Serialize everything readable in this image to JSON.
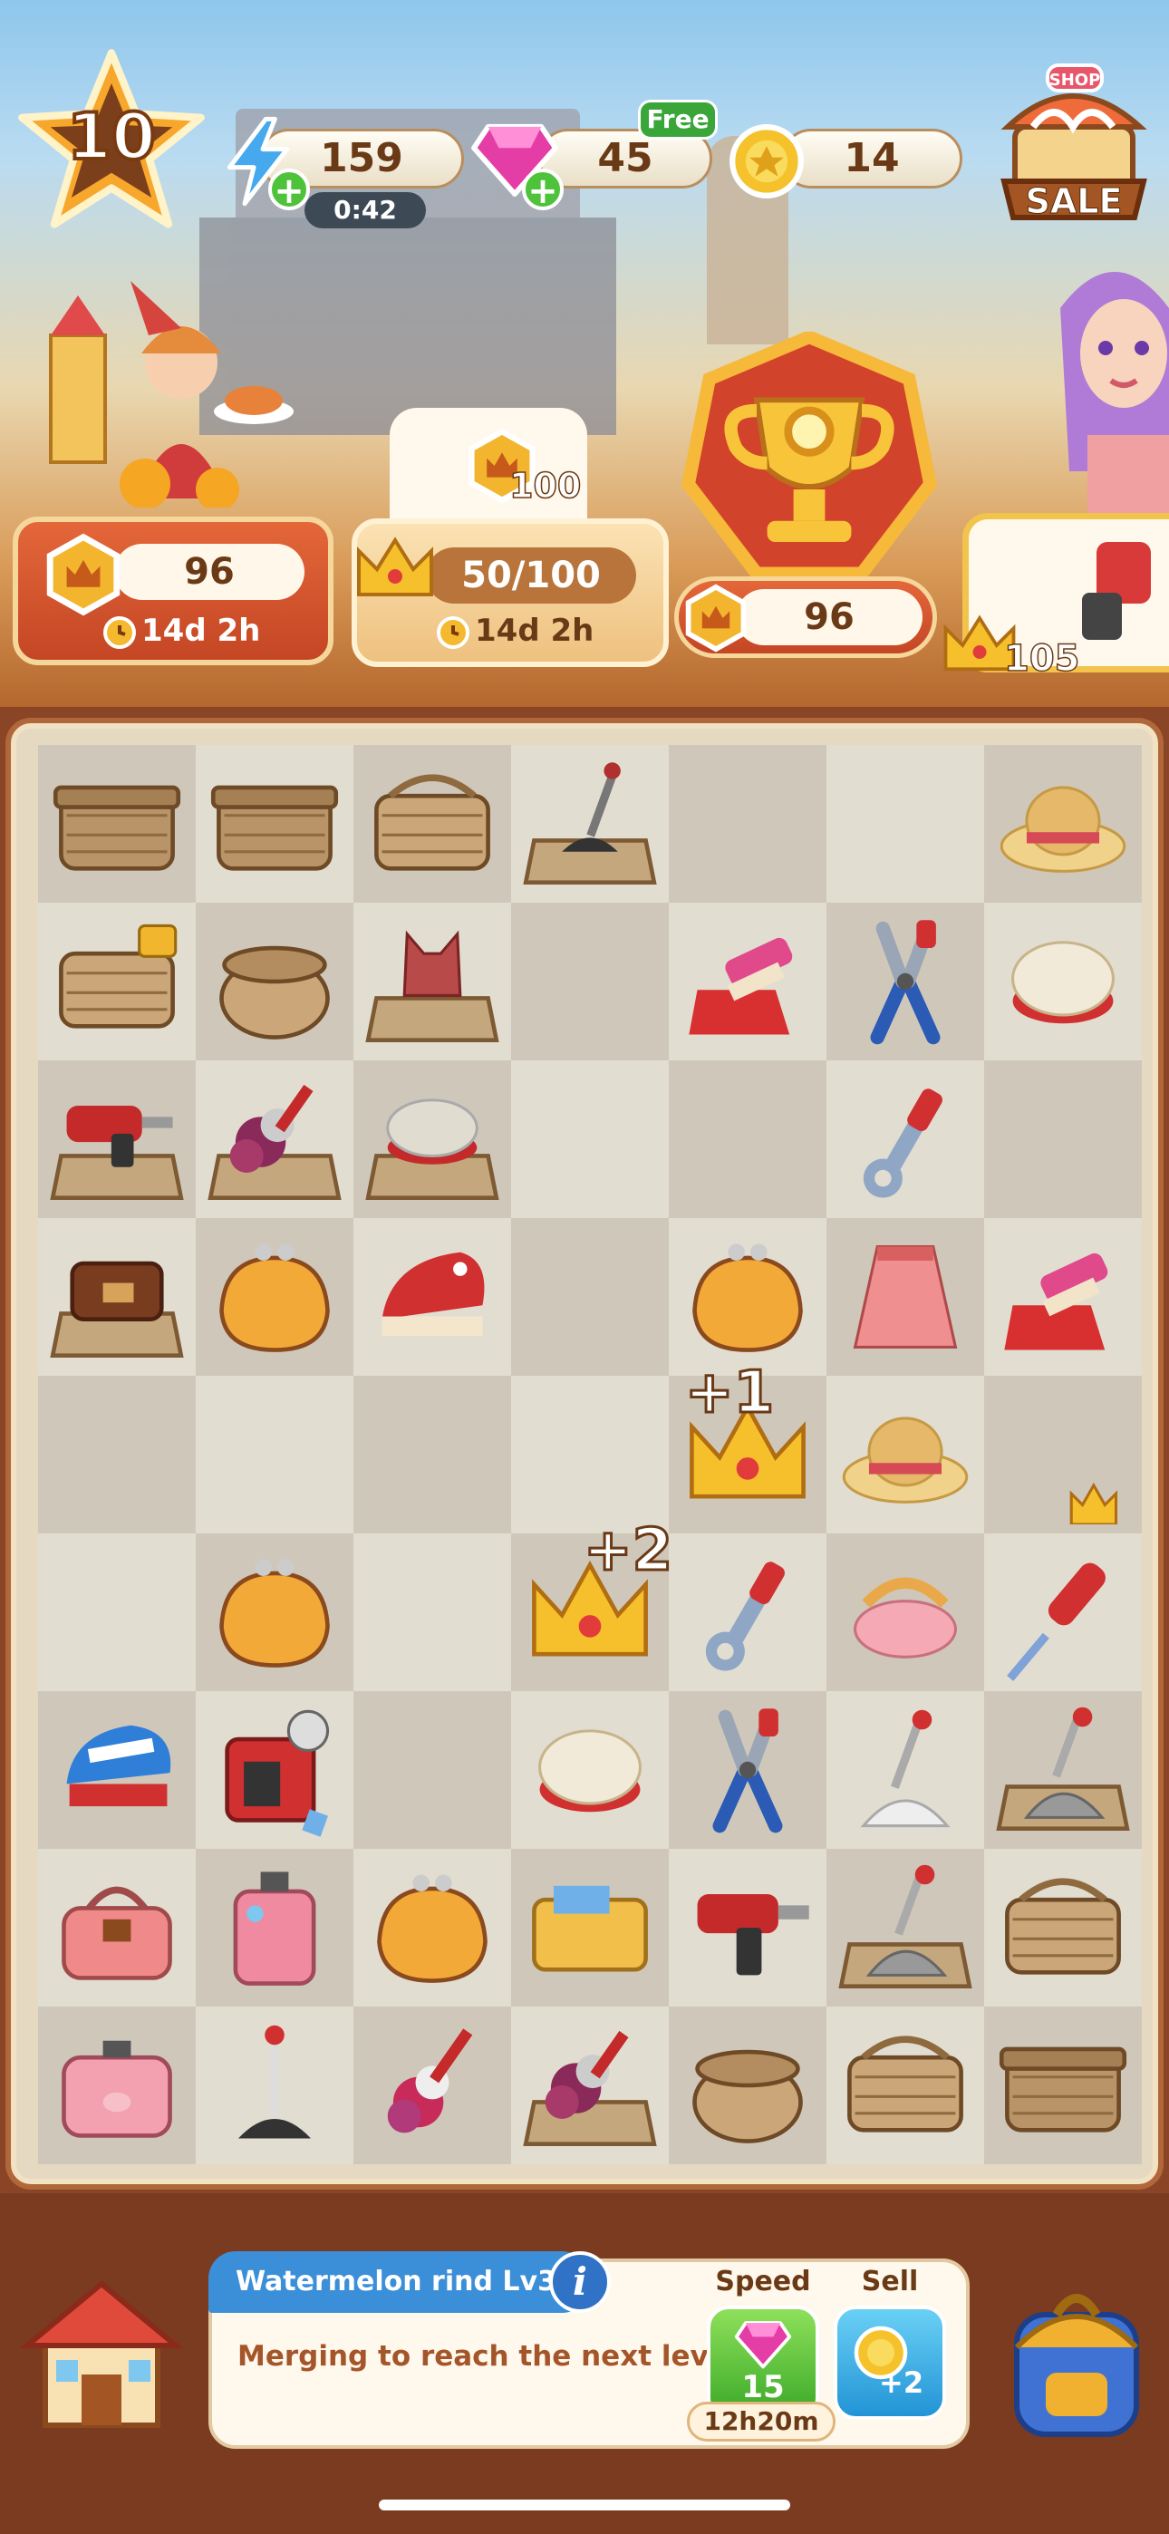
{
  "player": {
    "level": "10"
  },
  "resources": {
    "energy": "159",
    "energy_timer": "0:42",
    "gems": "45",
    "gems_badge": "Free",
    "coins": "14"
  },
  "shop": {
    "sign": "SHOP",
    "label": "SALE"
  },
  "events": {
    "left": {
      "value": "96",
      "time": "14d 2h"
    },
    "middle": {
      "reward": "100",
      "progress": "50/100",
      "time": "14d 2h"
    },
    "trophy": {
      "value": "96"
    },
    "right": {
      "value": "105"
    }
  },
  "board": {
    "floating_labels": [
      "+1",
      "+2"
    ],
    "rows": [
      [
        "picnic-basket-closed",
        "picnic-basket-closed",
        "wicker-basket",
        "plunger-on-mat",
        "",
        "",
        "straw-hat"
      ],
      [
        "wicker-basket-locked",
        "wicker-basket-round",
        "swimsuit-on-mat",
        "",
        "dustpan-brush",
        "pliers",
        "round-cake"
      ],
      [
        "power-drill-on-mat",
        "feather-duster-on-mat",
        "cake-on-mat",
        "",
        "",
        "wrench",
        ""
      ],
      [
        "leather-bag-on-mat",
        "coin-purse",
        "scrub-brush",
        "",
        "coin-purse",
        "pink-skirt",
        "dustpan-brush"
      ],
      [
        "",
        "",
        "",
        "",
        "crown-plus-one",
        "straw-hat",
        "small-crown"
      ],
      [
        "",
        "coin-purse",
        "",
        "crown-plus-two",
        "wrench",
        "pink-visor",
        "screwdriver"
      ],
      [
        "scrub-brush-blue",
        "red-generator",
        "",
        "round-cake",
        "pliers",
        "mop",
        "mop-on-mat"
      ],
      [
        "pink-handbag",
        "pink-suitcase",
        "coin-purse",
        "yellow-wallet",
        "power-drill",
        "mop-on-mat",
        "wicker-basket"
      ],
      [
        "pink-suitcase-small",
        "plunger",
        "feather-duster",
        "feather-duster-on-mat",
        "wicker-basket-round",
        "wicker-basket",
        "picnic-basket-closed"
      ]
    ]
  },
  "info_panel": {
    "item_name": "Watermelon rind Lv3",
    "info_icon": "i",
    "description": "Merging to reach the next level",
    "speed_label": "Speed",
    "speed_cost": "15",
    "speed_time": "12h20m",
    "sell_label": "Sell",
    "sell_value": "+2"
  },
  "colors": {
    "board_dark": "#cfc8ba",
    "board_light": "#e2ddd1",
    "accent": "#3b8ed8"
  }
}
